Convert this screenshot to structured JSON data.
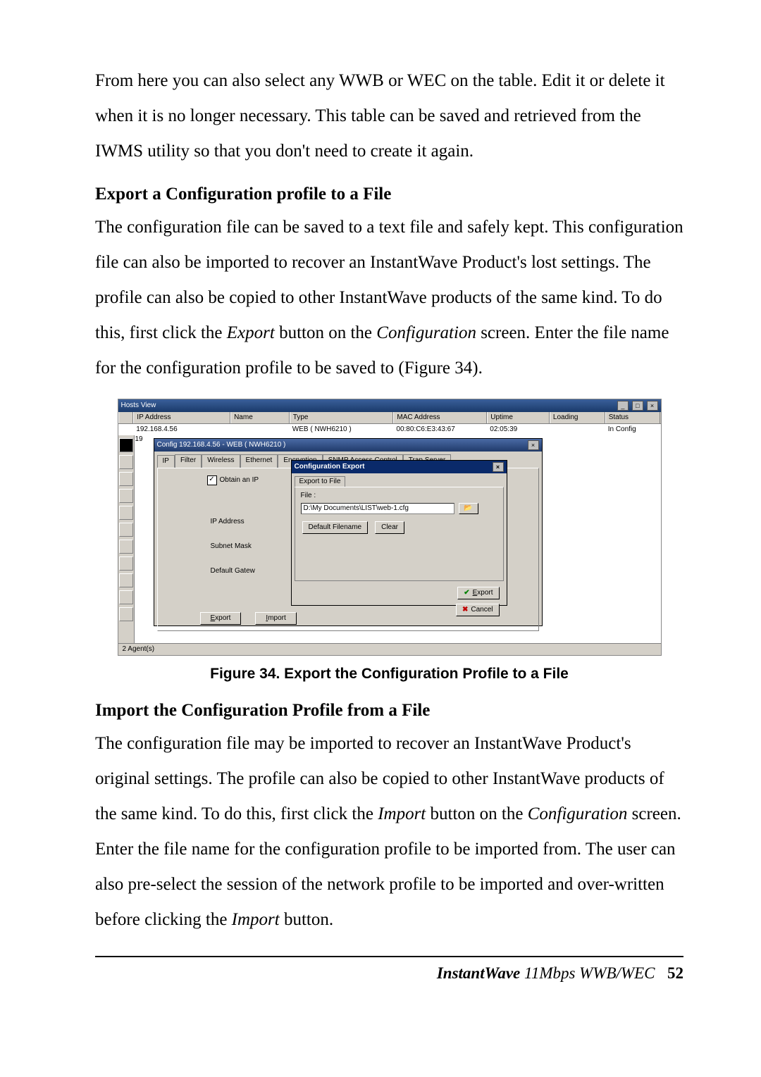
{
  "para1": "From here you can also select any WWB or WEC on the table. Edit it or delete it when it is no longer necessary.    This table can be saved and retrieved from the IWMS utility so that you don't need to create it again.",
  "head1": "Export a Configuration profile to a File",
  "para2a": "The configuration file can be saved to a text file and safely kept.    This configuration file can also be imported to recover an InstantWave Product's lost settings. The profile can also be copied to other InstantWave products of the same kind. To do this, first click the ",
  "para2b": " button on the ",
  "para2c": " screen. Enter the file name for the configuration profile to be saved to (Figure 34).",
  "export_word": "Export",
  "configuration_word": "Configuration",
  "import_word": "Import",
  "figcaption": "Figure 34.    Export the Configuration Profile to a File",
  "head2": "Import the Configuration Profile from a File",
  "para3a": "The configuration file may be imported to recover an InstantWave Product's original settings.    The profile can also be copied to other InstantWave products of the same kind. To do this, first click the ",
  "para3b": " button on the ",
  "para3c": " screen. Enter the file name for the configuration profile to be imported from.    The user can also pre-select the session of the network profile to be imported and over-written before clicking the ",
  "para3d": " button.",
  "footer": {
    "brand": "InstantWave",
    "model": " 11Mbps WWB/WEC",
    "page": "52"
  },
  "screenshot": {
    "window_title": "Hosts View",
    "headers": {
      "ip": "IP Address",
      "name": "Name",
      "type": "Type",
      "mac": "MAC Address",
      "uptime": "Uptime",
      "loading": "Loading",
      "status": "Status"
    },
    "row1": {
      "ip": "192.168.4.56",
      "name": "",
      "type": "WEB ( NWH6210 )",
      "mac": "00:80:C6:E3:43:67",
      "uptime": "02:05:39",
      "loading": "",
      "status": "In Config"
    },
    "row2_prefix": "19",
    "status_bar": "2 Agent(s)",
    "config": {
      "title": "Config 192.168.4.56 - WEB ( NWH6210 )",
      "tabs": [
        "IP",
        "Filter",
        "Wireless",
        "Ethernet",
        "Encryption",
        "SNMP Access Control",
        "Trap Server"
      ],
      "obtain_label": "Obtain an IP",
      "labels": {
        "ip": "IP Address",
        "subnet": "Subnet Mask",
        "gateway": "Default Gatew"
      },
      "buttons": {
        "export": "Export",
        "import": "Import"
      }
    },
    "export_dialog": {
      "title": "Configuration Export",
      "tab": "Export to File",
      "file_label": "File :",
      "file_value": "D:\\My Documents\\LIST\\web-1.cfg",
      "default_btn": "Default Filename",
      "clear_btn": "Clear",
      "export_btn": "Export",
      "cancel_btn": "Cancel"
    }
  }
}
